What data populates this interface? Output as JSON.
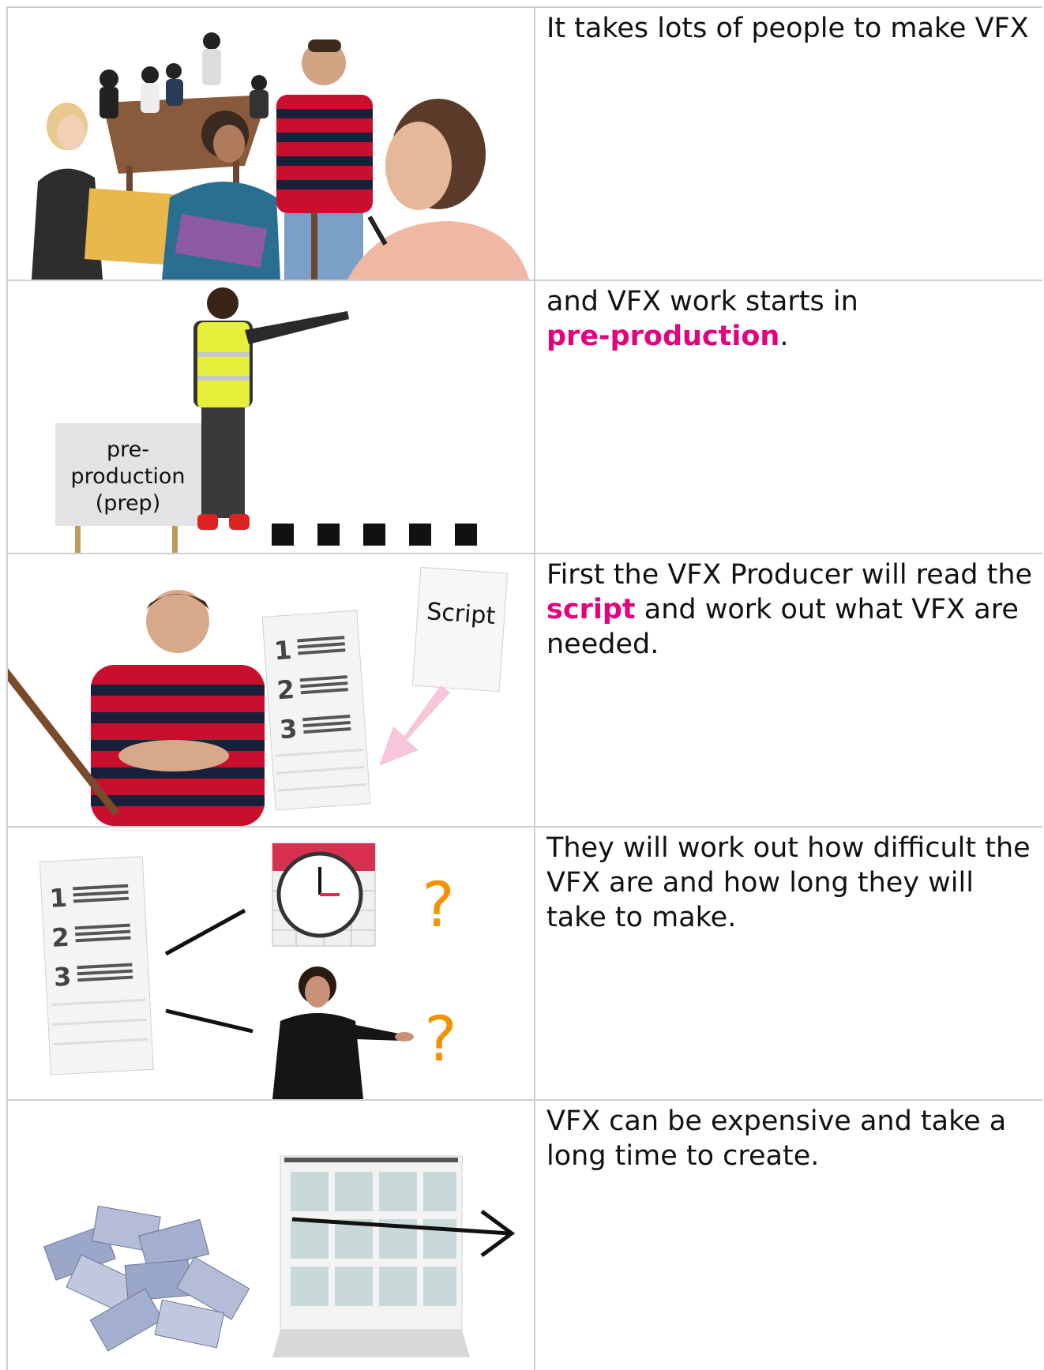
{
  "rows": [
    {
      "text": "It takes lots of people to make VFX",
      "image": "meeting-people-illustration"
    },
    {
      "text_before": "and VFX work starts in",
      "highlight": "pre-production",
      "text_after": ".",
      "image": "person-pointing-at-sign",
      "sign_line1": "pre-",
      "sign_line2": "production",
      "sign_line3": "(prep)"
    },
    {
      "text_before": "First the VFX Producer will read the",
      "highlight": "script",
      "text_after": "and work out what VFX are needed.",
      "image": "producer-with-script",
      "script_label": "Script",
      "list_numbers": [
        "1",
        "2",
        "3"
      ]
    },
    {
      "text": "They will work out how difficult the VFX are and how long they will take to make.",
      "image": "list-calendar-clock-question",
      "list_numbers": [
        "1",
        "2",
        "3"
      ],
      "question_mark": "?"
    },
    {
      "text": "VFX can be expensive and take a long time to create.",
      "image": "money-and-calendar"
    }
  ],
  "colors": {
    "highlight": "#e6007e",
    "border": "#cfcfcf",
    "question": "#f39200"
  }
}
